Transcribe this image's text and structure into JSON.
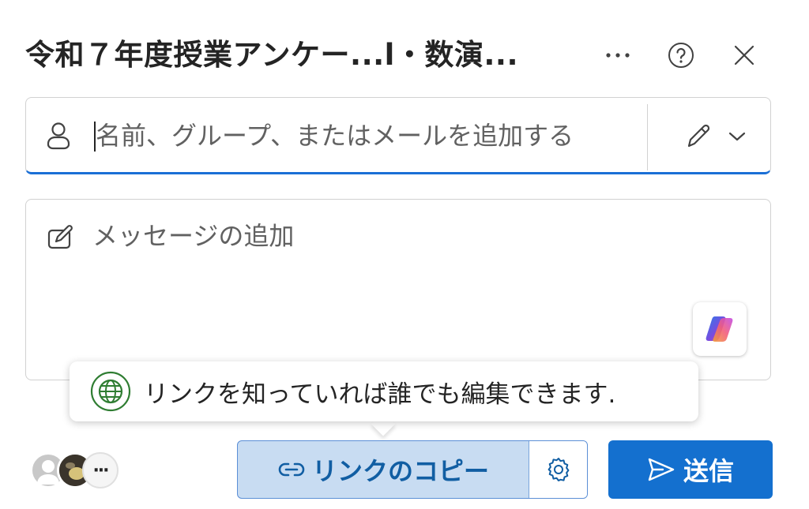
{
  "dialog": {
    "title": "令和７年度授業アンケー...l・数演...",
    "more_icon": "more-horizontal-icon",
    "help_icon": "help-circle-icon",
    "close_icon": "close-icon"
  },
  "recipients": {
    "placeholder": "名前、グループ、またはメールを追加する",
    "person_icon": "person-icon",
    "permission_icon": "pencil-icon",
    "dropdown_icon": "chevron-down-icon"
  },
  "message": {
    "placeholder": "メッセージの追加",
    "icon": "compose-icon",
    "copilot_icon": "copilot-icon"
  },
  "tooltip": {
    "text": "リンクを知っていれば誰でも編集できます.",
    "icon": "globe-icon"
  },
  "shared_with": {
    "more_label": "···"
  },
  "actions": {
    "copy_link_label": "リンクのコピー",
    "copy_link_icon": "link-icon",
    "settings_icon": "gear-icon",
    "send_label": "送信",
    "send_icon": "send-icon"
  },
  "colors": {
    "accent": "#1470cf",
    "copy_link_bg": "#c8dcf2",
    "globe_green": "#2f7d32"
  }
}
